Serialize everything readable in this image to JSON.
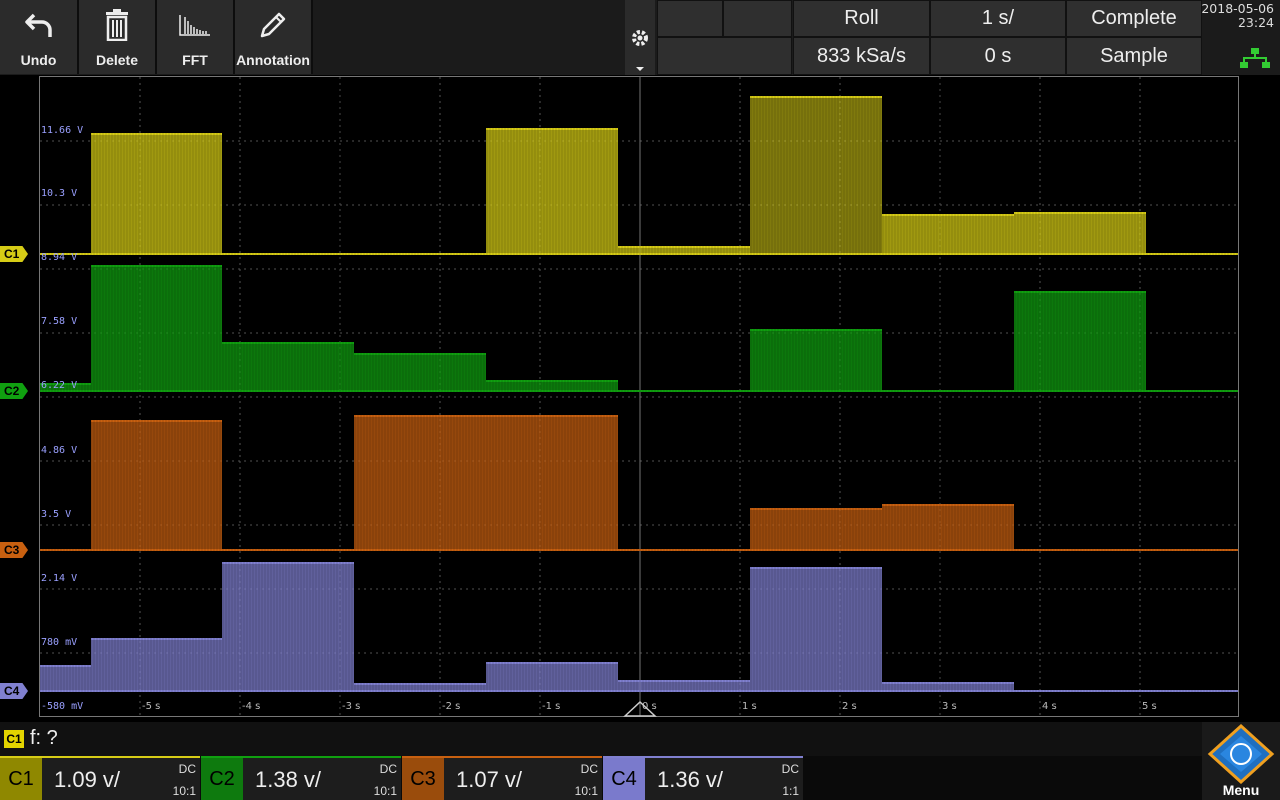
{
  "toolbar": {
    "buttons": [
      {
        "label": "Undo",
        "icon": "undo-arrow-icon"
      },
      {
        "label": "Delete",
        "icon": "trash-icon"
      },
      {
        "label": "FFT",
        "icon": "fft-spectrum-icon"
      },
      {
        "label": "Annotation",
        "icon": "pencil-icon"
      }
    ]
  },
  "acquisition": {
    "mode": "Roll",
    "time_scale": "1 s/",
    "status": "Complete",
    "sample_rate": "833 kSa/s",
    "offset": "0 s",
    "acq_type": "Sample"
  },
  "datetime": {
    "date": "2018-05-06",
    "time": "23:24"
  },
  "voltage_labels": [
    "11.66 V",
    "10.3 V",
    "8.94 V",
    "7.58 V",
    "6.22 V",
    "4.86 V",
    "3.5 V",
    "2.14 V",
    "780 mV",
    "-580 mV"
  ],
  "time_labels": [
    "-5 s",
    "-4 s",
    "-3 s",
    "-2 s",
    "-1 s",
    "0 s",
    "1 s",
    "2 s",
    "3 s",
    "4 s",
    "5 s"
  ],
  "measurement": {
    "channel": "C1",
    "text": "f: ?"
  },
  "channels": [
    {
      "name": "C1",
      "scale": "1.09 v/",
      "coupling": "DC",
      "probe": "10:1",
      "color": "#d6cc16"
    },
    {
      "name": "C2",
      "scale": "1.38 v/",
      "coupling": "DC",
      "probe": "10:1",
      "color": "#10a010"
    },
    {
      "name": "C3",
      "scale": "1.07 v/",
      "coupling": "DC",
      "probe": "10:1",
      "color": "#c86010"
    },
    {
      "name": "C4",
      "scale": "1.36 v/",
      "coupling": "DC",
      "probe": "1:1",
      "color": "#8080d0"
    }
  ],
  "menu_label": "Menu"
}
